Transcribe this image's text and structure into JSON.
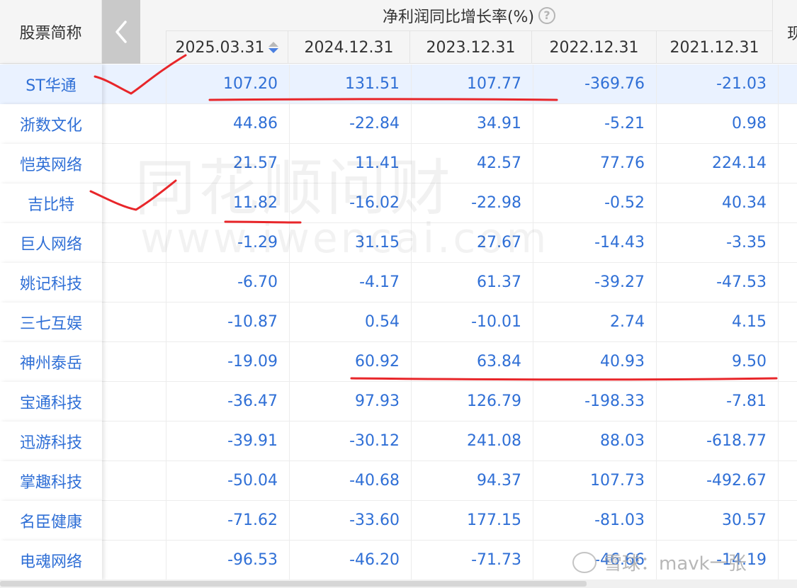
{
  "header": {
    "name_col": "股票简称",
    "group_title": "净利润同比增长率(%)",
    "help": "?",
    "next_col": "现",
    "dates": [
      "2025.03.31",
      "2024.12.31",
      "2023.12.31",
      "2022.12.31",
      "2021.12.31"
    ]
  },
  "rows": [
    {
      "name": "ST华通",
      "v": [
        "107.20",
        "131.51",
        "107.77",
        "-369.76",
        "-21.03"
      ]
    },
    {
      "name": "浙数文化",
      "v": [
        "44.86",
        "-22.84",
        "34.91",
        "-5.21",
        "0.98"
      ]
    },
    {
      "name": "恺英网络",
      "v": [
        "21.57",
        "11.41",
        "42.57",
        "77.76",
        "224.14"
      ]
    },
    {
      "name": "吉比特",
      "v": [
        "11.82",
        "-16.02",
        "-22.98",
        "-0.52",
        "40.34"
      ]
    },
    {
      "name": "巨人网络",
      "v": [
        "-1.29",
        "31.15",
        "27.67",
        "-14.43",
        "-3.35"
      ]
    },
    {
      "name": "姚记科技",
      "v": [
        "-6.70",
        "-4.17",
        "61.37",
        "-39.27",
        "-47.53"
      ]
    },
    {
      "name": "三七互娱",
      "v": [
        "-10.87",
        "0.54",
        "-10.01",
        "2.74",
        "4.15"
      ]
    },
    {
      "name": "神州泰岳",
      "v": [
        "-19.09",
        "60.92",
        "63.84",
        "40.93",
        "9.50"
      ]
    },
    {
      "name": "宝通科技",
      "v": [
        "-36.47",
        "97.93",
        "126.79",
        "-198.33",
        "-7.81"
      ]
    },
    {
      "name": "迅游科技",
      "v": [
        "-39.91",
        "-30.12",
        "241.08",
        "88.03",
        "-618.77"
      ]
    },
    {
      "name": "掌趣科技",
      "v": [
        "-50.04",
        "-40.68",
        "94.37",
        "107.73",
        "-492.67"
      ]
    },
    {
      "name": "名臣健康",
      "v": [
        "-71.62",
        "-33.60",
        "177.15",
        "-81.03",
        "30.57"
      ]
    },
    {
      "name": "电魂网络",
      "v": [
        "-96.53",
        "-46.20",
        "-71.73",
        "-46.66",
        "-14.19"
      ]
    }
  ],
  "watermarks": {
    "brand": "同花顺问财",
    "url": "www.iwencai.com",
    "corner": "雪球：mavk一张"
  },
  "colors": {
    "link_blue": "#2f6fd6",
    "selected_row": "#eaf2ff",
    "annotation_red": "#e8262a"
  }
}
